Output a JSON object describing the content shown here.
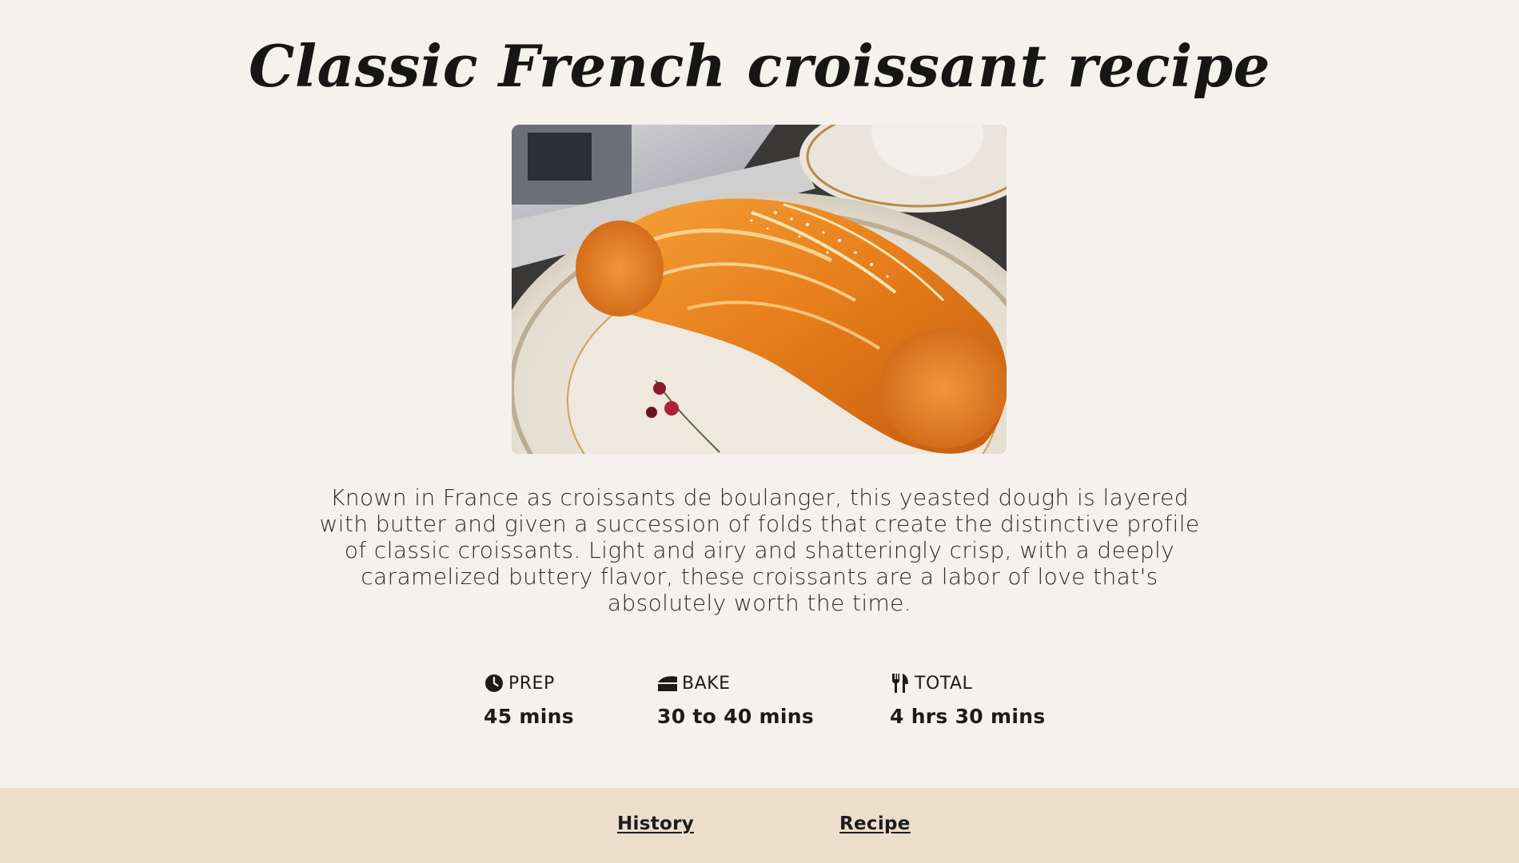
{
  "page": {
    "title": "Classic French croissant recipe",
    "description": "Known in France as croissants de boulanger, this yeasted dough is layered with butter and given a succession of folds that create the distinctive profile of classic croissants. Light and airy and shatteringly crisp, with a deeply caramelized buttery flavor, these croissants are a labor of love that's absolutely worth the time."
  },
  "hero_image": {
    "subject": "croissant on a plate"
  },
  "stats": {
    "prep": {
      "icon": "clock-icon",
      "label": "PREP",
      "value": "45 mins"
    },
    "bake": {
      "icon": "cake-slice-icon",
      "label": "BAKE",
      "value": "30 to 40 mins"
    },
    "total": {
      "icon": "utensils-icon",
      "label": "TOTAL",
      "value": "4 hrs 30 mins"
    }
  },
  "footer": {
    "links": [
      "History",
      "Recipe"
    ]
  },
  "colors": {
    "background": "#f5f2ed",
    "footer_background": "#ecdecb",
    "text": "#1c1c1c"
  }
}
